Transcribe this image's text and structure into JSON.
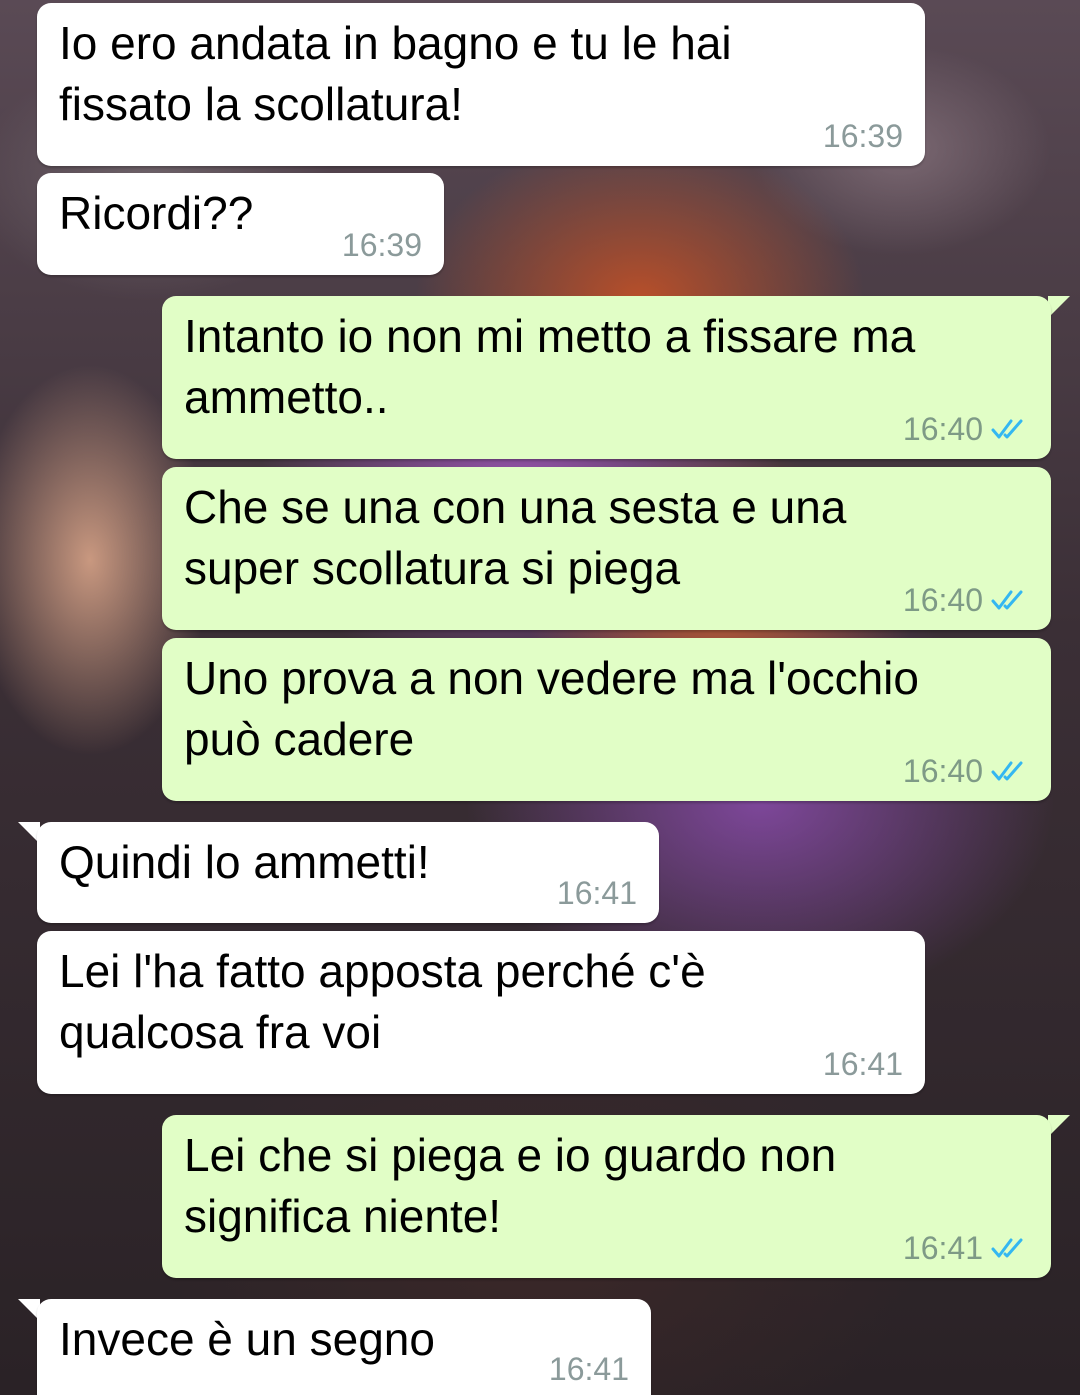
{
  "messages": [
    {
      "dir": "in",
      "text": "Io ero andata in bagno e tu le hai\nfissato la scollatura!",
      "time": "16:39",
      "status": ""
    },
    {
      "dir": "in",
      "text": "Ricordi??",
      "time": "16:39",
      "status": ""
    },
    {
      "dir": "out",
      "text": "Intanto io non mi metto a fissare ma\nammetto..",
      "time": "16:40",
      "status": "read"
    },
    {
      "dir": "out",
      "text": "Che se una con una sesta e una\nsuper scollatura si piega",
      "time": "16:40",
      "status": "read"
    },
    {
      "dir": "out",
      "text": "Uno prova a non vedere ma l'occhio\npuò cadere",
      "time": "16:40",
      "status": "read"
    },
    {
      "dir": "in",
      "text": "Quindi lo ammetti!",
      "time": "16:41",
      "status": ""
    },
    {
      "dir": "in",
      "text": "Lei l'ha fatto apposta perché c'è\nqualcosa fra voi",
      "time": "16:41",
      "status": ""
    },
    {
      "dir": "out",
      "text": "Lei che si piega e io guardo non\nsignifica niente!",
      "time": "16:41",
      "status": "read"
    },
    {
      "dir": "in",
      "text": "Invece è un segno",
      "time": "16:41",
      "status": ""
    }
  ],
  "icons": {
    "read_receipt": "double-check-icon"
  },
  "colors": {
    "incoming_bubble": "#ffffff",
    "outgoing_bubble": "#e1fec6",
    "read_tick": "#34b7f1",
    "timestamp": "#8b9a9a"
  }
}
